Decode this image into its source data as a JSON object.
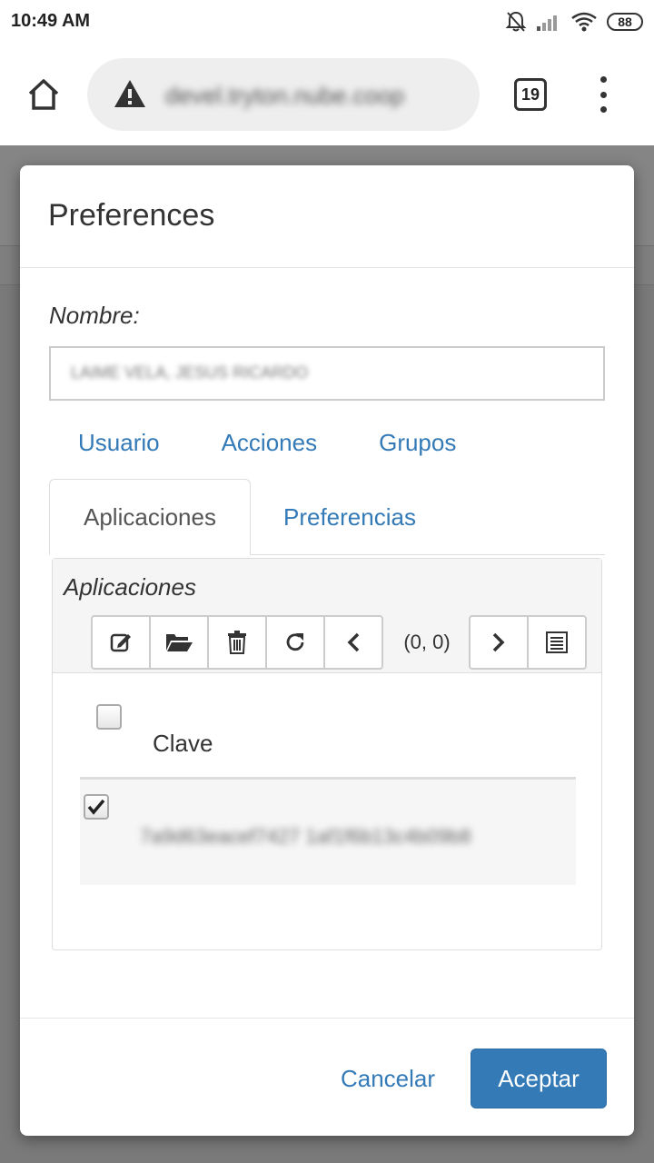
{
  "status_bar": {
    "time": "10:49 AM",
    "battery": "88"
  },
  "browser": {
    "url": "devel.tryton.nube.coop",
    "tab_count": "19"
  },
  "dialog": {
    "title": "Preferences",
    "name_label": "Nombre:",
    "name_value": "LAIME VELA, JESUS RICARDO",
    "tabs": [
      "Usuario",
      "Acciones",
      "Grupos"
    ],
    "sub_tabs": {
      "active": "Aplicaciones",
      "other": "Preferencias"
    },
    "panel": {
      "title": "Aplicaciones",
      "record_count": "(0, 0)",
      "column_label": "Clave",
      "row_value": "7a9d63eacef7427 1af1f6b13c4b09b8"
    },
    "buttons": {
      "cancel": "Cancelar",
      "accept": "Aceptar"
    }
  },
  "colors": {
    "accent": "#337ab7",
    "overlay": "#7a7a7a"
  }
}
